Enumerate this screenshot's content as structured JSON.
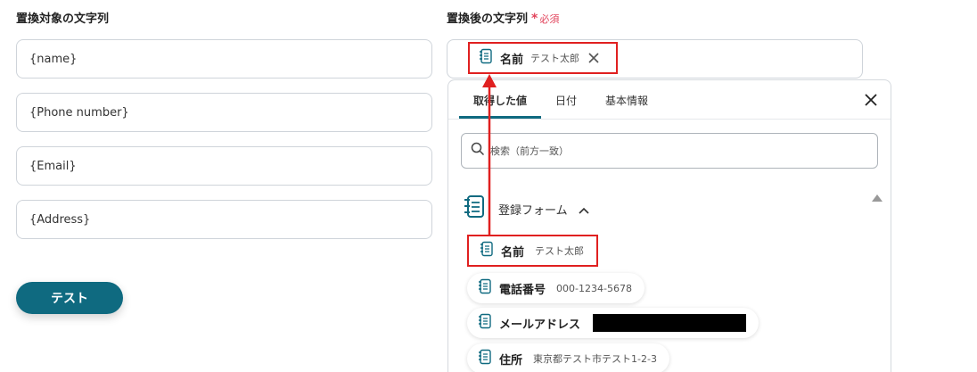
{
  "source": {
    "label": "置換対象の文字列",
    "fields": [
      "{name}",
      "{Phone number}",
      "{Email}",
      "{Address}"
    ]
  },
  "test_button": {
    "label": "テスト"
  },
  "dest": {
    "label": "置換後の文字列",
    "required_mark": "*",
    "required_text": "必須",
    "selected_chip": {
      "name": "名前",
      "value": "テスト太郎"
    }
  },
  "dropdown": {
    "tabs": [
      "取得した値",
      "日付",
      "基本情報"
    ],
    "active_tab": "取得した値",
    "search_placeholder": "検索（前方一致）",
    "group": {
      "label": "登録フォーム",
      "items": [
        {
          "name": "名前",
          "value": "テスト太郎"
        },
        {
          "name": "電話番号",
          "value": "000-1234-5678"
        },
        {
          "name": "メールアドレス",
          "value": ""
        },
        {
          "name": "住所",
          "value": "東京都テスト市テスト1-2-3"
        }
      ]
    }
  },
  "colors": {
    "accent": "#0f6a80",
    "highlight": "#e02020",
    "required": "#e2445c"
  },
  "icons": {
    "item": "form-field-icon",
    "group": "form-group-icon",
    "search": "search-icon",
    "close": "close-icon",
    "chevron": "chevron-up-icon"
  }
}
